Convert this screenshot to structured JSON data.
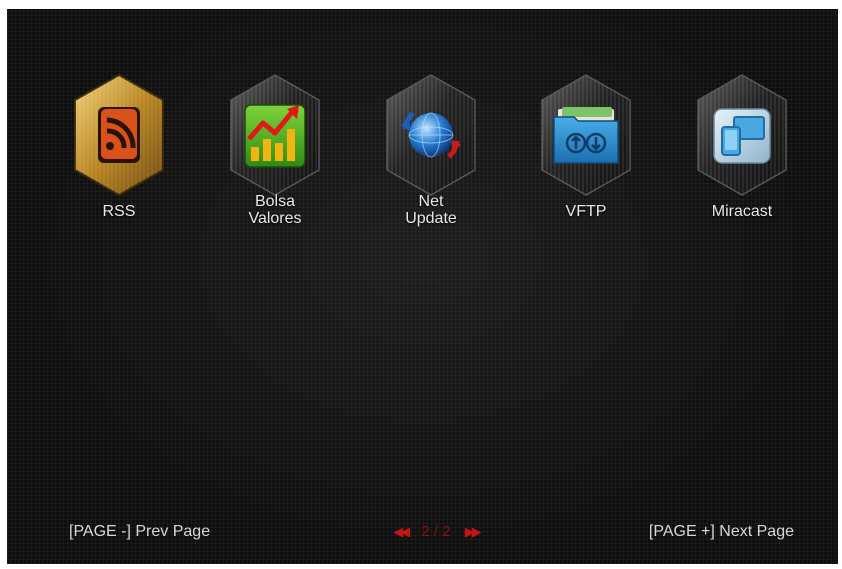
{
  "apps": [
    {
      "label_line1": "RSS",
      "label_line2": "",
      "icon": "rss-icon"
    },
    {
      "label_line1": "Bolsa",
      "label_line2": "Valores",
      "icon": "stock-chart-icon"
    },
    {
      "label_line1": "Net",
      "label_line2": "Update",
      "icon": "globe-update-icon"
    },
    {
      "label_line1": "VFTP",
      "label_line2": "",
      "icon": "folder-transfer-icon"
    },
    {
      "label_line1": "Miracast",
      "label_line2": "",
      "icon": "screen-mirror-icon"
    }
  ],
  "footer": {
    "prev_label": "[PAGE -] Prev Page",
    "next_label": "[PAGE +] Next Page",
    "page_indicator": "2 / 2"
  },
  "colors": {
    "background": "#0e0e0e",
    "text": "#e8e8e8",
    "pager_accent": "#c41414",
    "rss_gold": "#c8962a",
    "hex_frame": "#2a2a2a"
  }
}
